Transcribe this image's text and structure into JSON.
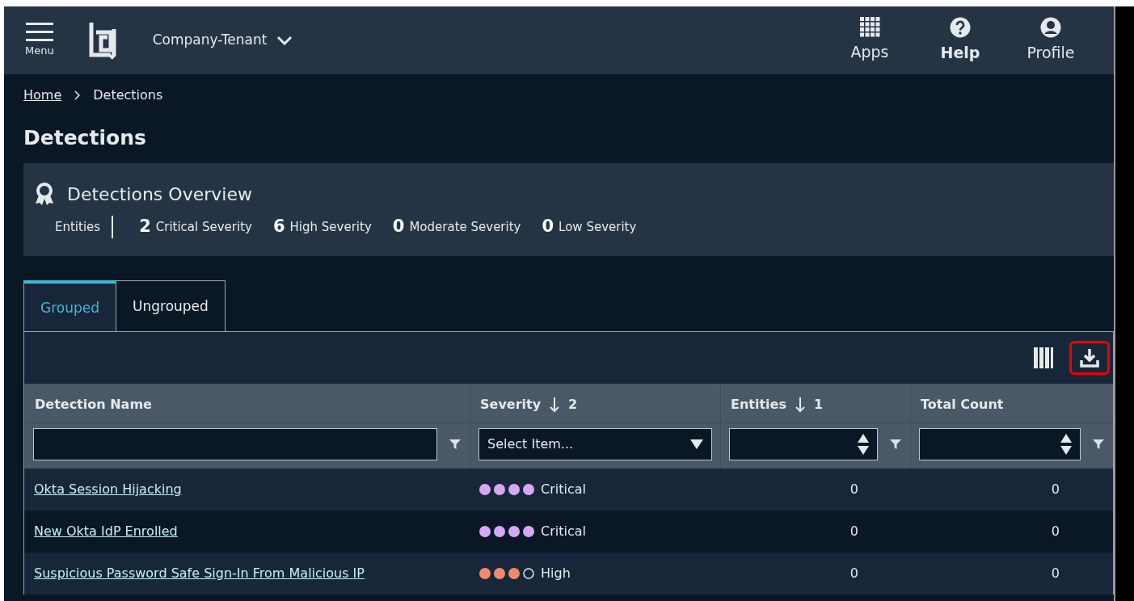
{
  "header": {
    "menu_label": "Menu",
    "tenant": "Company-Tenant",
    "actions": [
      {
        "label": "Apps",
        "kind": "apps",
        "bold": false
      },
      {
        "label": "Help",
        "kind": "help",
        "bold": true
      },
      {
        "label": "Profile",
        "kind": "profile",
        "bold": false
      }
    ]
  },
  "breadcrumb": [
    {
      "label": "Home",
      "link": true
    },
    {
      "label": "Detections",
      "link": false
    }
  ],
  "page_title": "Detections",
  "overview": {
    "title": "Detections Overview",
    "entities_label": "Entities",
    "counts": [
      {
        "count": "2",
        "severity": "Critical Severity"
      },
      {
        "count": "6",
        "severity": "High Severity"
      },
      {
        "count": "0",
        "severity": "Moderate Severity"
      },
      {
        "count": "0",
        "severity": "Low Severity"
      }
    ]
  },
  "tabs": [
    {
      "label": "Grouped",
      "selected": true
    },
    {
      "label": "Ungrouped",
      "selected": false
    }
  ],
  "toolbar": {
    "download_highlighted": true
  },
  "table": {
    "columns": [
      {
        "label": "Detection Name",
        "kind": "text"
      },
      {
        "label": "Severity",
        "sort_order": "2",
        "kind": "select",
        "placeholder": "Select Item..."
      },
      {
        "label": "Entities",
        "sort_order": "1",
        "kind": "number"
      },
      {
        "label": "Total Count",
        "kind": "number"
      }
    ],
    "rows": [
      {
        "name": "Okta Session Hijacking",
        "stars": 4,
        "color": "#d5a8f5",
        "severity": "Critical",
        "entities": "0",
        "total_count": "0"
      },
      {
        "name": "New Okta IdP Enrolled",
        "stars": 4,
        "color": "#d5a8f5",
        "severity": "Critical",
        "entities": "0",
        "total_count": "0"
      },
      {
        "name": "Suspicious Password Safe Sign-In From Malicious IP",
        "stars": 3,
        "color": "#f08a6e",
        "severity": "High",
        "entities": "0",
        "total_count": "0"
      }
    ]
  }
}
